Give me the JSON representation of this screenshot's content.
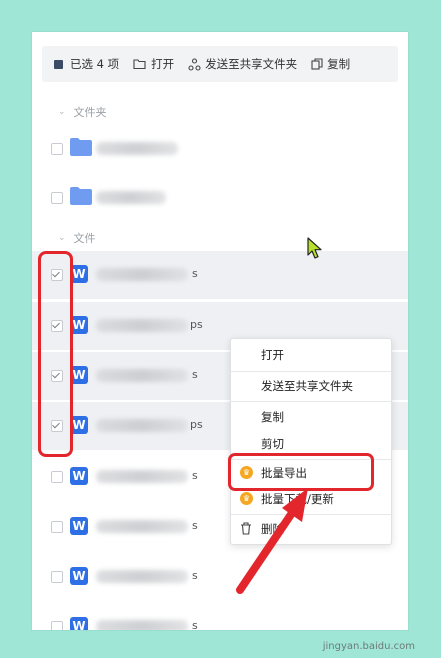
{
  "toolbar": {
    "selected_label": "已选 4 项",
    "open_label": "打开",
    "send_label": "发送至共享文件夹",
    "copy_label": "复制"
  },
  "sections": {
    "folders_label": "文件夹",
    "files_label": "文件"
  },
  "files": [
    {
      "suffix": "s",
      "checked": true
    },
    {
      "suffix": "ps",
      "checked": true
    },
    {
      "suffix": "s",
      "checked": true
    },
    {
      "suffix": "ps",
      "checked": true
    },
    {
      "suffix": "s",
      "checked": false
    },
    {
      "suffix": "s",
      "checked": false
    },
    {
      "suffix": "s",
      "checked": false
    },
    {
      "suffix": "s",
      "checked": false
    }
  ],
  "context_menu": {
    "open": "打开",
    "send": "发送至共享文件夹",
    "copy": "复制",
    "cut": "剪切",
    "batch_export": "批量导出",
    "batch_download": "批量下载/更新",
    "delete": "删除"
  },
  "colors": {
    "background": "#9fe6d6",
    "annotation_red": "#e3262c",
    "word_icon_blue": "#2e6fe6",
    "folder_blue": "#6f9cf0",
    "premium_orange": "#f5a623"
  },
  "watermark": "jingyan.baidu.com"
}
